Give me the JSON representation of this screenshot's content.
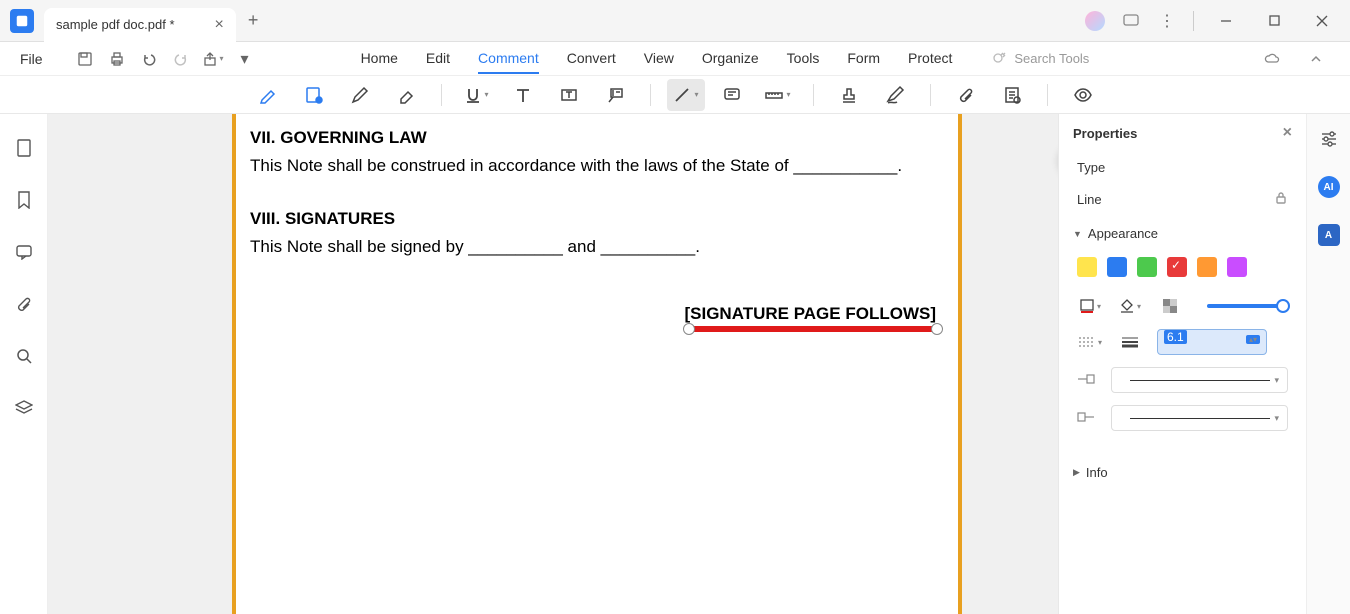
{
  "tab": {
    "title": "sample pdf doc.pdf *"
  },
  "menu": {
    "file": "File",
    "tabs": [
      "Home",
      "Edit",
      "Comment",
      "Convert",
      "View",
      "Organize",
      "Tools",
      "Form",
      "Protect"
    ],
    "active_tab": "Comment",
    "search_placeholder": "Search Tools"
  },
  "doc": {
    "h1": "VII. GOVERNING LAW",
    "p1": "This Note shall be construed in accordance with the laws of the State of ___________.",
    "h2": "VIII. SIGNATURES",
    "p2": "This Note shall be signed by __________ and __________.",
    "sig": "[SIGNATURE PAGE FOLLOWS]"
  },
  "props": {
    "title": "Properties",
    "type_label": "Type",
    "type_value": "Line",
    "appearance": "Appearance",
    "info": "Info",
    "colors": [
      {
        "hex": "#ffe44d",
        "sel": false
      },
      {
        "hex": "#2c7cf0",
        "sel": false
      },
      {
        "hex": "#4dc94d",
        "sel": false
      },
      {
        "hex": "#e83a3a",
        "sel": true
      },
      {
        "hex": "#ff9933",
        "sel": false
      },
      {
        "hex": "#c94dff",
        "sel": false
      }
    ],
    "thickness_value": "6.1"
  }
}
